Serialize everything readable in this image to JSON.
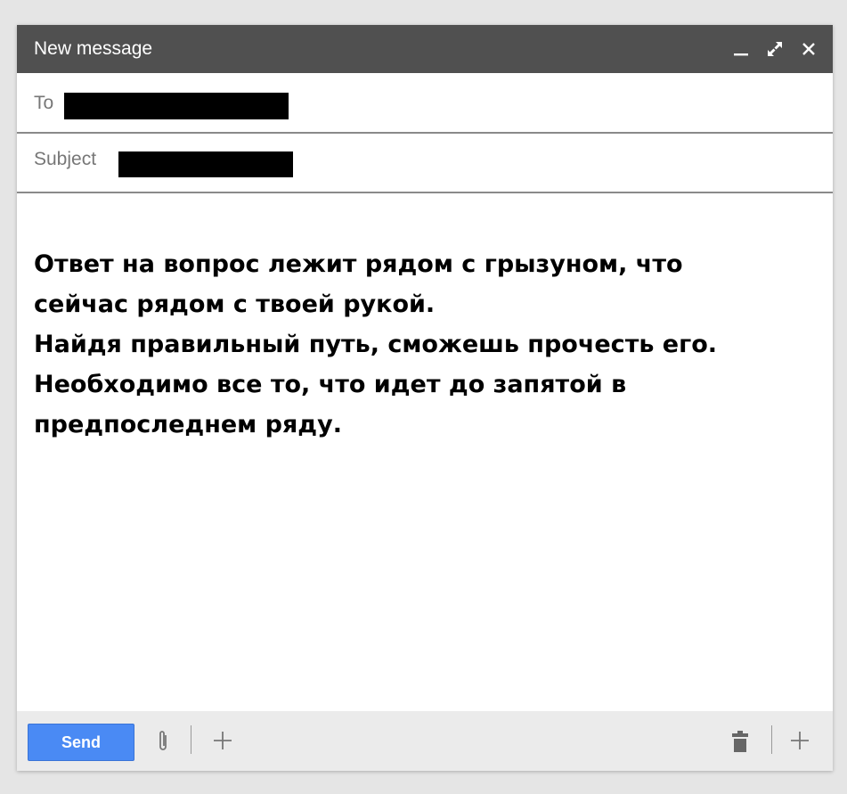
{
  "window": {
    "title": "New message",
    "controls": [
      "minimize-icon",
      "expand-icon",
      "close-icon"
    ]
  },
  "fields": {
    "to_label": "To",
    "to_value": "",
    "subject_label": "Subject",
    "subject_value": ""
  },
  "body": {
    "lines": [
      "Ответ на вопрос лежит рядом с грызуном, что",
      "сейчас рядом с твоей рукой.",
      "Найдя правильный путь, сможешь прочесть его.",
      "Необходимо все то, что идет до запятой в",
      "предпоследнем ряду."
    ]
  },
  "toolbar": {
    "send_label": "Send",
    "icons": [
      "paperclip-icon",
      "plus-icon",
      "trash-icon",
      "plus-icon"
    ]
  },
  "colors": {
    "titlebar": "#505050",
    "send_button": "#4a8af4",
    "bottombar": "#ebebeb",
    "redaction": "#000000"
  }
}
